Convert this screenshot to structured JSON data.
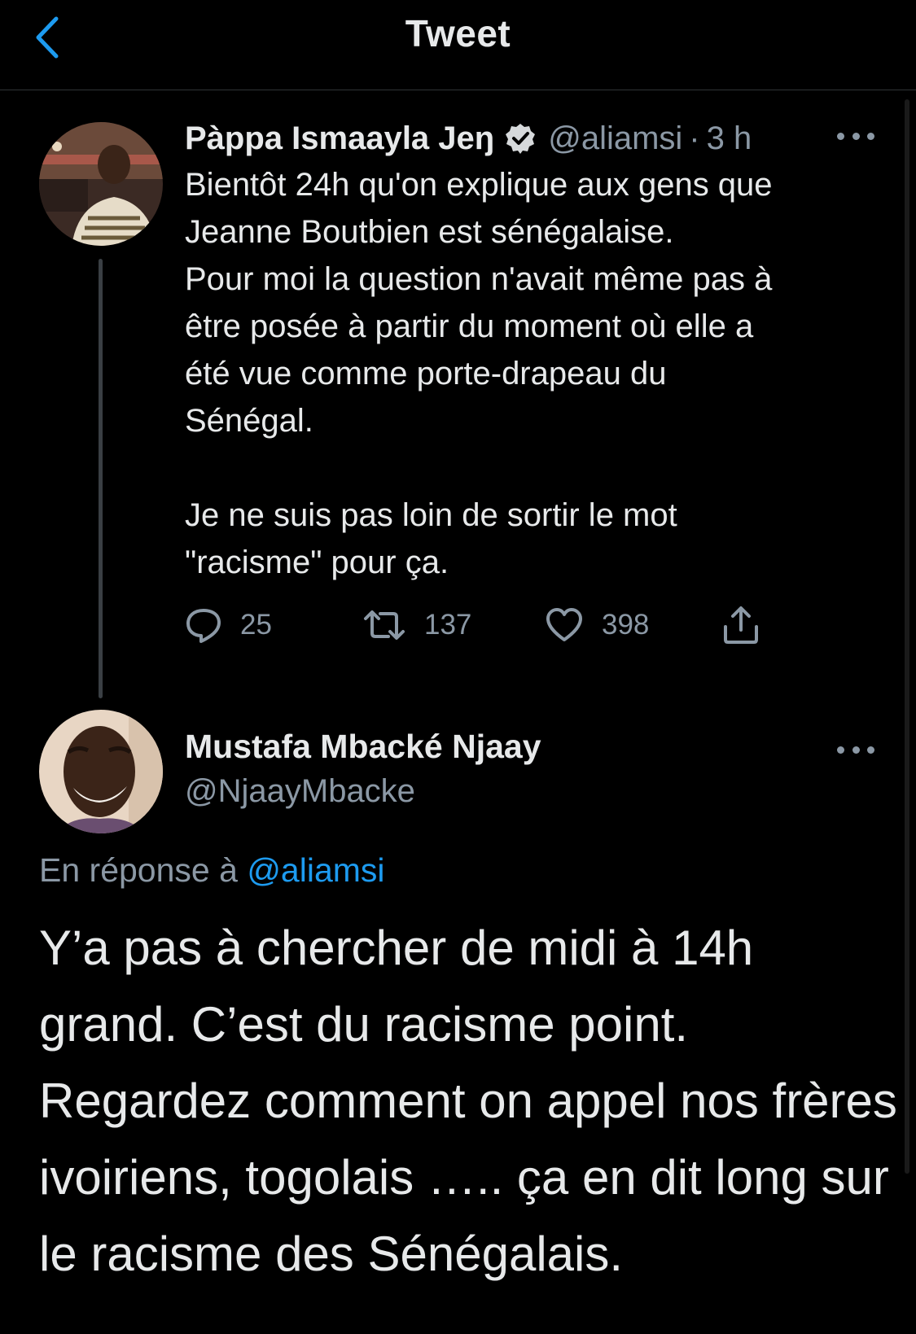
{
  "header": {
    "title": "Tweet",
    "back_icon": "chevron-left-icon",
    "accent_color": "#1d9bf0"
  },
  "parent_tweet": {
    "display_name": "Pàppa Ismaayla Jeŋ",
    "verified": true,
    "handle": "@aliamsi",
    "separator": "·",
    "time": "3 h",
    "text": "Bientôt 24h qu'on explique aux gens que\nJeanne Boutbien est sénégalaise.\nPour moi la question n'avait même pas à\nêtre posée à partir du moment où elle a\nété vue comme porte-drapeau du\nSénégal.\n\nJe ne suis pas loin de sortir le mot\n\"racisme\" pour ça.",
    "stats": {
      "replies": "25",
      "retweets": "137",
      "likes": "398"
    }
  },
  "reply_tweet": {
    "display_name": "Mustafa Mbacké Njaay",
    "handle": "@NjaayMbacke",
    "reply_prefix": "En réponse à",
    "reply_to_handle": "@aliamsi",
    "text": "Y’a pas à chercher de midi à 14h grand. C’est du racisme point. Regardez comment on appel nos frères ivoiriens, togolais ….. ça en dit long sur le racisme des Sénégalais."
  }
}
